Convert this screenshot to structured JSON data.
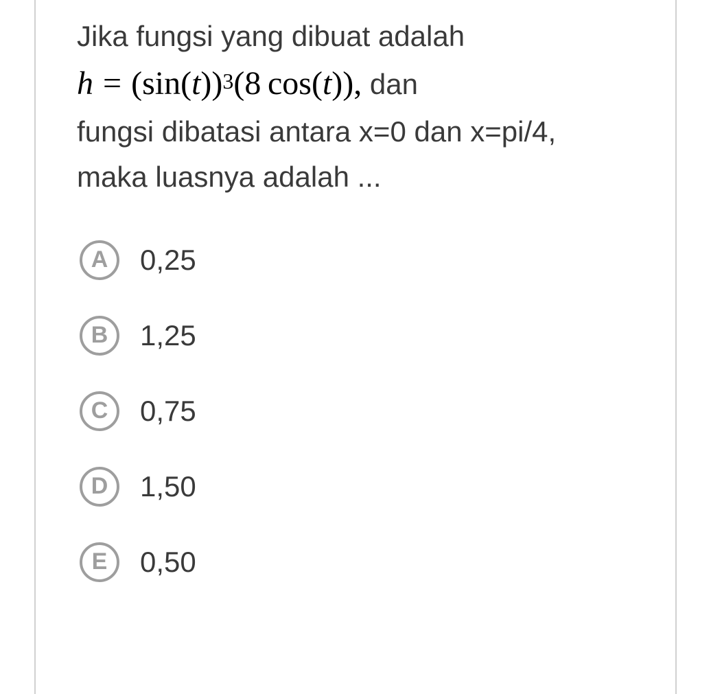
{
  "question": {
    "line1": "Jika fungsi yang dibuat adalah",
    "formula": {
      "var": "h",
      "eq": "=",
      "body_open": "(",
      "sin": "sin",
      "t_open": "(",
      "t": "t",
      "t_close": ")",
      "body_close": ")",
      "exp": "3",
      "mult_open": "(",
      "coef": "8",
      "cos": "cos",
      "t2_open": "(",
      "t2": "t",
      "t2_close": ")",
      "mult_close": ")",
      "comma": ","
    },
    "after_formula": "dan",
    "line3": "fungsi dibatasi antara x=0 dan x=pi/4,",
    "line4": "maka luasnya adalah ..."
  },
  "options": [
    {
      "letter": "A",
      "text": "0,25"
    },
    {
      "letter": "B",
      "text": "1,25"
    },
    {
      "letter": "C",
      "text": "0,75"
    },
    {
      "letter": "D",
      "text": "1,50"
    },
    {
      "letter": "E",
      "text": "0,50"
    }
  ]
}
